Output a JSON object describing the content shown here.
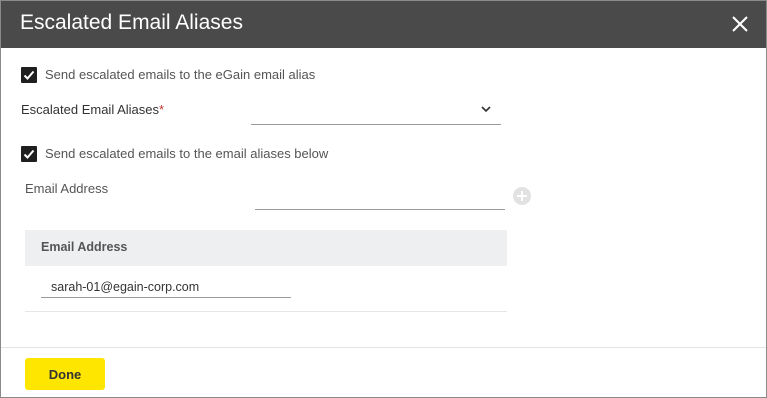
{
  "dialog": {
    "title": "Escalated Email Aliases",
    "close_icon": "close-icon"
  },
  "option_egain_alias": {
    "checked": true,
    "label": "Send escalated emails to the eGain email alias"
  },
  "aliases_field": {
    "label": "Escalated Email Aliases",
    "required_mark": "*",
    "selected_value": "",
    "chevron_icon": "chevron-down-icon"
  },
  "option_aliases_below": {
    "checked": true,
    "label": "Send escalated emails to the email aliases below"
  },
  "email_field": {
    "label": "Email Address",
    "value": "",
    "add_icon": "plus-circle-icon"
  },
  "email_table": {
    "columns": [
      "Email Address"
    ],
    "rows": [
      {
        "email": "sarah-01@egain-corp.com"
      }
    ]
  },
  "footer": {
    "done_label": "Done"
  },
  "colors": {
    "header_bg": "#4a4a4a",
    "primary_button": "#ffe600",
    "required": "#c0392b"
  }
}
